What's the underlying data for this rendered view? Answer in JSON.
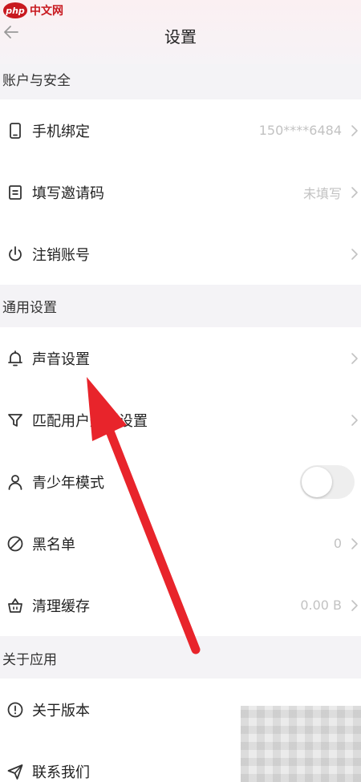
{
  "watermark": {
    "logo": "php",
    "text": "中文网"
  },
  "header": {
    "title": "设置"
  },
  "sections": [
    {
      "title": "账户与安全",
      "items": [
        {
          "label": "手机绑定",
          "value": "150****6484",
          "icon": "phone-icon",
          "control": "chevron"
        },
        {
          "label": "填写邀请码",
          "value": "未填写",
          "icon": "document-icon",
          "control": "chevron"
        },
        {
          "label": "注销账号",
          "value": "",
          "icon": "power-icon",
          "control": "chevron"
        }
      ]
    },
    {
      "title": "通用设置",
      "items": [
        {
          "label": "声音设置",
          "value": "",
          "icon": "bell-icon",
          "control": "chevron"
        },
        {
          "label": "匹配用户规则设置",
          "value": "",
          "icon": "filter-icon",
          "control": "chevron"
        },
        {
          "label": "青少年模式",
          "value": "",
          "icon": "person-icon",
          "control": "toggle",
          "toggle_on": false
        },
        {
          "label": "黑名单",
          "value": "0",
          "icon": "block-icon",
          "control": "chevron"
        },
        {
          "label": "清理缓存",
          "value": "0.00 B",
          "icon": "basket-icon",
          "control": "chevron"
        }
      ]
    },
    {
      "title": "关于应用",
      "items": [
        {
          "label": "关于版本",
          "value": "",
          "icon": "info-icon",
          "control": "none"
        },
        {
          "label": "联系我们",
          "value": "",
          "icon": "send-icon",
          "control": "none"
        }
      ]
    }
  ],
  "colors": {
    "annotation_arrow": "#e8242b",
    "accent_watermark": "#c8191f"
  }
}
